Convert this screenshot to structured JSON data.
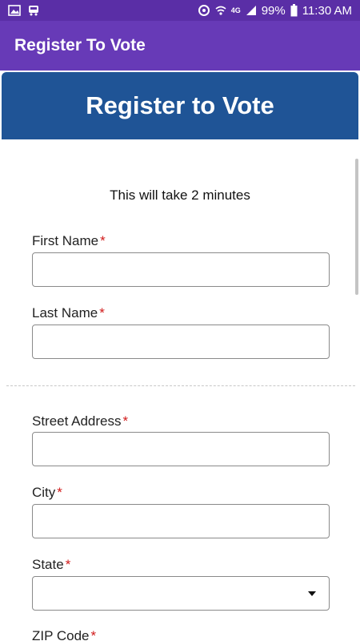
{
  "status_bar": {
    "battery": "99%",
    "time": "11:30 AM",
    "network": "4G"
  },
  "app_bar": {
    "title": "Register To Vote"
  },
  "banner": {
    "title": "Register to Vote"
  },
  "form": {
    "subtitle": "This will take 2 minutes",
    "required_marker": "*",
    "fields": {
      "first_name": {
        "label": "First Name",
        "value": ""
      },
      "last_name": {
        "label": "Last Name",
        "value": ""
      },
      "street_address": {
        "label": "Street Address",
        "value": ""
      },
      "city": {
        "label": "City",
        "value": ""
      },
      "state": {
        "label": "State",
        "value": ""
      },
      "zip_code": {
        "label": "ZIP Code",
        "value": ""
      }
    }
  },
  "colors": {
    "status_bar": "#5a2ea6",
    "app_bar": "#673ab7",
    "banner": "#1f5496",
    "required": "#d11a1a"
  }
}
